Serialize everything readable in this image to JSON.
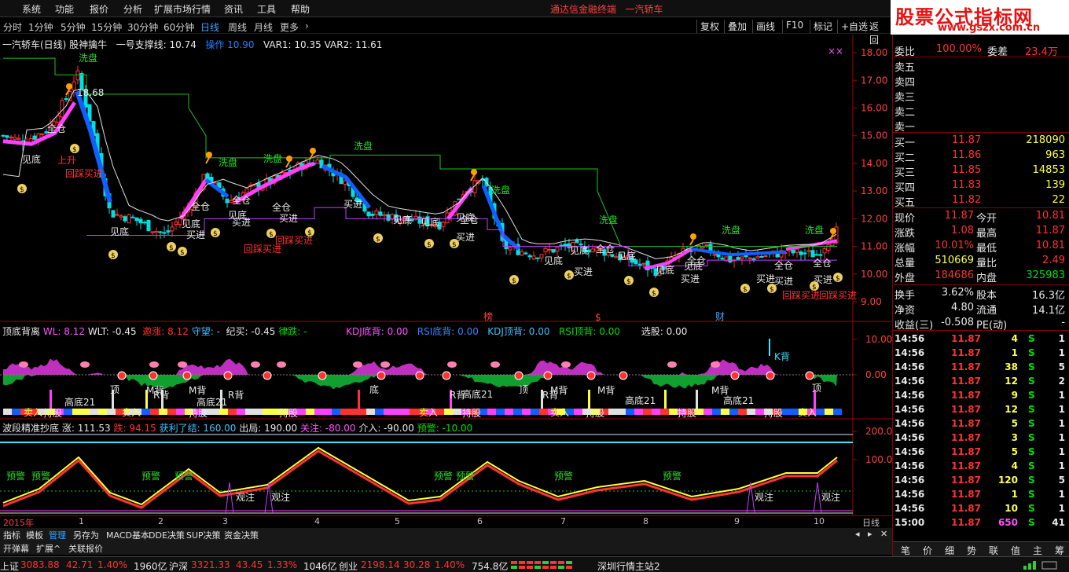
{
  "menu": {
    "items": [
      "系统",
      "功能",
      "报价",
      "分析",
      "扩展市场行情",
      "资讯",
      "工具",
      "帮助"
    ],
    "app_title": "通达信金融终端",
    "stock_title": "一汽轿车"
  },
  "logo": {
    "line1": "股票公式指标网",
    "line2": "www.gszx.com.cn"
  },
  "periods": [
    "分时",
    "1分钟",
    "5分钟",
    "15分钟",
    "30分钟",
    "60分钟",
    "日线",
    "周线",
    "月线",
    "更多",
    "›"
  ],
  "period_active": "日线",
  "toolbar": [
    "复权",
    "叠加",
    "画线",
    "F10",
    "标记",
    "+自选",
    "返回"
  ],
  "main_header": {
    "name": "一汽轿车(日线) 股神擒牛",
    "support": "一号支撑线: 10.74",
    "op": "操作 10.90",
    "var1": "VAR1: 10.35",
    "var2": "VAR2: 11.61"
  },
  "sub1_header": {
    "name": "顶底背离",
    "wl": "WL: 8.12",
    "wlt": "WLT: -0.45",
    "up": "邀涨: 8.12",
    "watch": "守望: -",
    "ji": "纪买: -0.45",
    "lv": "律跌: -",
    "kdj_bot": "KDJ底背: 0.00",
    "rsi_bot": "RSI底背: 0.00",
    "kdj_top": "KDJ顶背: 0.00",
    "rsi_top": "RSI顶背: 0.00",
    "sel": "选股: 0.00"
  },
  "sub2_header": {
    "name": "波段精准抄底",
    "zhang": "涨: 111.53",
    "die": "跌: 94.15",
    "profit": "获利了结: 160.00",
    "exit": "出局: 190.00",
    "focus": "关注: -80.00",
    "enter": "介入: -90.00",
    "warn": "预警: -10.00"
  },
  "price_axis": [
    "18.00",
    "17.00",
    "16.00",
    "15.00",
    "14.00",
    "13.00",
    "12.00",
    "11.00",
    "10.00",
    "9.00"
  ],
  "sub1_axis": [
    "10.00",
    "0.00"
  ],
  "sub2_axis": [
    "200.0",
    "100.0"
  ],
  "xaxis": {
    "labels": [
      "2015年",
      "1",
      "2",
      "3",
      "4",
      "5",
      "6",
      "7",
      "8",
      "9",
      "10"
    ],
    "period": "日线"
  },
  "annotations": {
    "washout": "洗盘",
    "bottom": "见底",
    "fullpos": "全仓",
    "buy": "买进",
    "pullback_buy": "回踩买进",
    "high_price": "18.68",
    "rise": "上升",
    "warn": "预警",
    "watch": "观注",
    "hold": "持股",
    "sell": "卖入",
    "top_div": "顶",
    "bottom_div": "底",
    "m_back": "M背",
    "r_back": "R背",
    "k_back": "K背",
    "high_low": "高底21"
  },
  "markers": {
    "rank": "榜",
    "money": "$",
    "finance": "财"
  },
  "bottom_tabs": [
    "指标",
    "模板",
    "管理",
    "另存为",
    "MACD基本",
    "DDE决策",
    "SUP决策",
    "资金决策"
  ],
  "bottom_tabs2": [
    "开弹幕",
    "扩展^",
    "关联报价"
  ],
  "quote": {
    "weibi_label": "委比",
    "weibi_val": "100.00%",
    "weicha_label": "委差",
    "weicha_val": "23.4万",
    "sells": [
      {
        "label": "卖五",
        "price": "",
        "vol": ""
      },
      {
        "label": "卖四",
        "price": "",
        "vol": ""
      },
      {
        "label": "卖三",
        "price": "",
        "vol": ""
      },
      {
        "label": "卖二",
        "price": "",
        "vol": ""
      },
      {
        "label": "卖一",
        "price": "",
        "vol": ""
      }
    ],
    "buys": [
      {
        "label": "买一",
        "price": "11.87",
        "vol": "218090"
      },
      {
        "label": "买二",
        "price": "11.86",
        "vol": "963"
      },
      {
        "label": "买三",
        "price": "11.85",
        "vol": "14853"
      },
      {
        "label": "买四",
        "price": "11.83",
        "vol": "139"
      },
      {
        "label": "买五",
        "price": "11.82",
        "vol": "22"
      }
    ],
    "stats": [
      {
        "l1": "现价",
        "v1": "11.87",
        "c1": "red",
        "l2": "今开",
        "v2": "10.81",
        "c2": "red"
      },
      {
        "l1": "涨跌",
        "v1": "1.08",
        "c1": "red",
        "l2": "最高",
        "v2": "11.87",
        "c2": "red"
      },
      {
        "l1": "涨幅",
        "v1": "10.01%",
        "c1": "red",
        "l2": "最低",
        "v2": "10.81",
        "c2": "red"
      },
      {
        "l1": "总量",
        "v1": "510669",
        "c1": "yel",
        "l2": "量比",
        "v2": "2.49",
        "c2": "red"
      },
      {
        "l1": "外盘",
        "v1": "184686",
        "c1": "red",
        "l2": "内盘",
        "v2": "325983",
        "c2": "grn"
      }
    ],
    "stats2": [
      {
        "l1": "换手",
        "v1": "3.62%",
        "l2": "股本",
        "v2": "16.3亿"
      },
      {
        "l1": "净资",
        "v1": "4.80",
        "l2": "流通",
        "v2": "14.1亿"
      },
      {
        "l1": "收益(三)",
        "v1": "-0.508",
        "l2": "PE(动)",
        "v2": "-"
      }
    ]
  },
  "ticks": [
    {
      "t": "14:56",
      "p": "11.87",
      "v": "4",
      "s": "S",
      "n": "1"
    },
    {
      "t": "14:56",
      "p": "11.87",
      "v": "1",
      "s": "S",
      "n": "1"
    },
    {
      "t": "14:56",
      "p": "11.87",
      "v": "38",
      "s": "S",
      "n": "5"
    },
    {
      "t": "14:56",
      "p": "11.87",
      "v": "12",
      "s": "S",
      "n": "2"
    },
    {
      "t": "14:56",
      "p": "11.87",
      "v": "9",
      "s": "S",
      "n": "1"
    },
    {
      "t": "14:56",
      "p": "11.87",
      "v": "12",
      "s": "S",
      "n": "1"
    },
    {
      "t": "14:56",
      "p": "11.87",
      "v": "5",
      "s": "S",
      "n": "1"
    },
    {
      "t": "14:56",
      "p": "11.87",
      "v": "3",
      "s": "S",
      "n": "1"
    },
    {
      "t": "14:56",
      "p": "11.87",
      "v": "5",
      "s": "S",
      "n": "1"
    },
    {
      "t": "14:56",
      "p": "11.87",
      "v": "4",
      "s": "S",
      "n": "1"
    },
    {
      "t": "14:56",
      "p": "11.87",
      "v": "120",
      "s": "S",
      "n": "5"
    },
    {
      "t": "14:56",
      "p": "11.87",
      "v": "1",
      "s": "S",
      "n": "1"
    },
    {
      "t": "14:56",
      "p": "11.87",
      "v": "10",
      "s": "S",
      "n": "1"
    },
    {
      "t": "15:00",
      "p": "11.87",
      "v": "650",
      "s": "S",
      "n": "41"
    }
  ],
  "rtabs": [
    "笔",
    "价",
    "细",
    "势",
    "联",
    "值",
    "主",
    "筹"
  ],
  "status": [
    {
      "name": "上证",
      "price": "3083.88",
      "chg": "42.71",
      "pct": "1.40%",
      "amt": "1960亿"
    },
    {
      "name": "沪深",
      "price": "3321.33",
      "chg": "43.45",
      "pct": "1.33%",
      "amt": "1046亿"
    },
    {
      "name": "创业",
      "price": "2198.14",
      "chg": "30.28",
      "pct": "1.40%",
      "amt": "754.8亿"
    }
  ],
  "status_server": "深圳行情主站2",
  "colors": {
    "up": "#ff3232",
    "down": "#00e0e0",
    "ma": "#e0e0e0",
    "wash": "#20c020",
    "support": "#c040ff"
  }
}
